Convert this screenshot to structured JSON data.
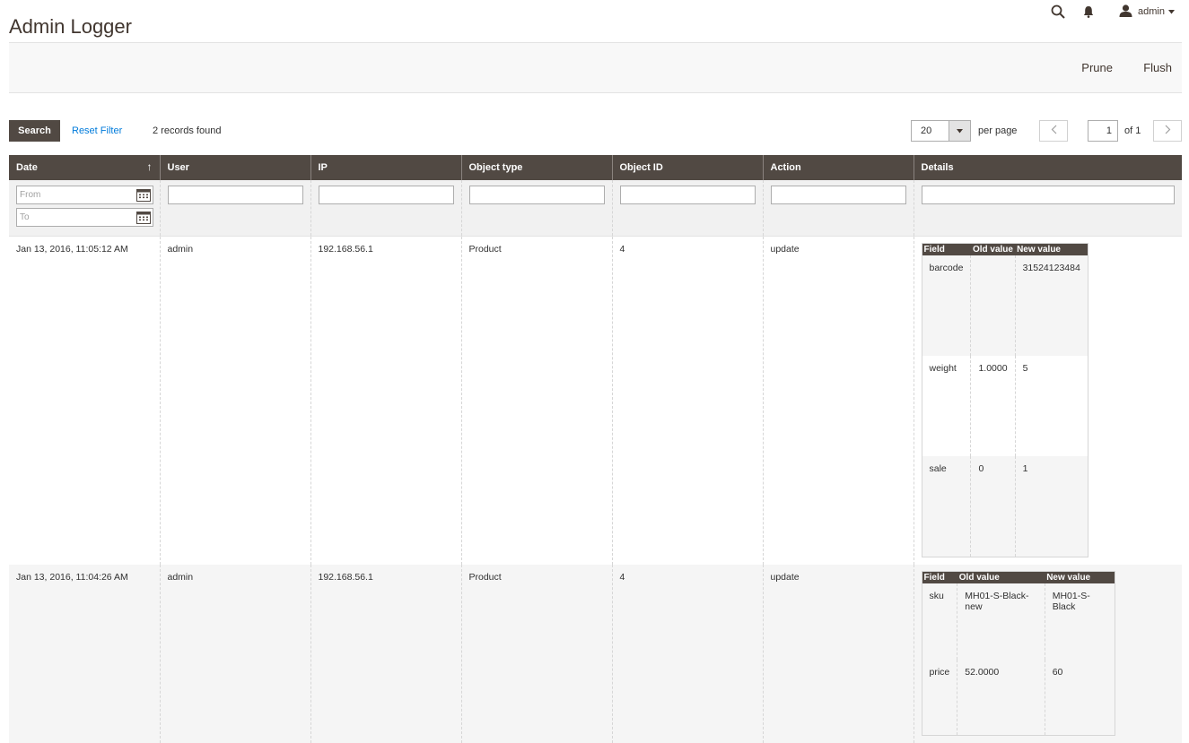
{
  "header": {
    "title": "Admin Logger",
    "user_name": "admin"
  },
  "action_bar": {
    "prune_label": "Prune",
    "flush_label": "Flush"
  },
  "toolbar": {
    "search_label": "Search",
    "reset_label": "Reset Filter",
    "records_found": "2 records found",
    "per_page_value": "20",
    "per_page_label": "per page",
    "page_value": "1",
    "page_of": "of 1"
  },
  "grid": {
    "columns": [
      "Date",
      "User",
      "IP",
      "Object type",
      "Object ID",
      "Action",
      "Details"
    ],
    "filters": {
      "date_from_placeholder": "From",
      "date_to_placeholder": "To"
    },
    "rows": [
      {
        "date": "Jan 13, 2016, 11:05:12 AM",
        "user": "admin",
        "ip": "192.168.56.1",
        "object_type": "Product",
        "object_id": "4",
        "action": "update",
        "details": {
          "headers": [
            "Field",
            "Old value",
            "New value"
          ],
          "rows": [
            [
              "barcode",
              "",
              "31524123484"
            ],
            [
              "weight",
              "1.0000",
              "5"
            ],
            [
              "sale",
              "0",
              "1"
            ]
          ]
        }
      },
      {
        "date": "Jan 13, 2016, 11:04:26 AM",
        "user": "admin",
        "ip": "192.168.56.1",
        "object_type": "Product",
        "object_id": "4",
        "action": "update",
        "details": {
          "headers": [
            "Field",
            "Old value",
            "New value"
          ],
          "rows": [
            [
              "sku",
              "MH01-S-Black-new",
              "MH01-S-Black"
            ],
            [
              "price",
              "52.0000",
              "60"
            ]
          ]
        }
      }
    ]
  },
  "icons": {
    "search": "search-icon",
    "notifications": "bell-icon",
    "user": "user-icon",
    "calendar": "calendar-icon",
    "prev": "chevron-left-icon",
    "next": "chevron-right-icon",
    "dropdown": "caret-down-icon",
    "sort": "sort-up-arrow-icon"
  },
  "colors": {
    "header_bg": "#514943",
    "link": "#007bdb",
    "title": "#41362f"
  }
}
